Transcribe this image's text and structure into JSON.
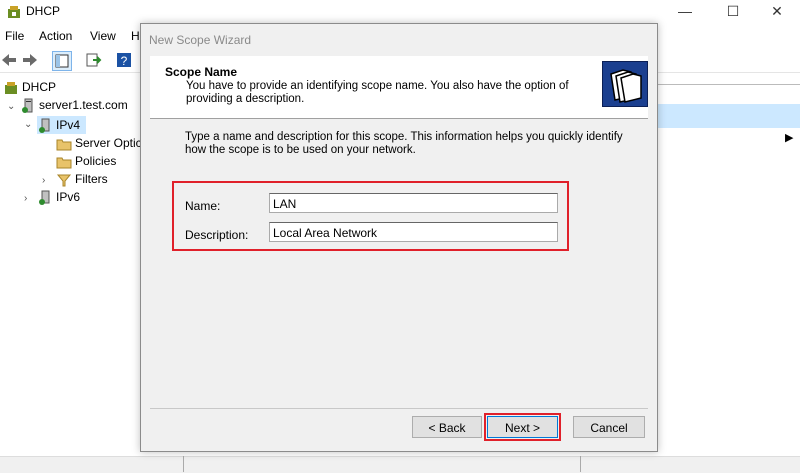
{
  "window": {
    "title": "DHCP",
    "controls": {
      "minimize": "—",
      "maximize": "☐",
      "close": "✕"
    }
  },
  "menubar": {
    "items": [
      "File",
      "Action",
      "View",
      "H"
    ]
  },
  "tree": {
    "root": "DHCP",
    "server": "server1.test.com",
    "ipv4": "IPv4",
    "server_options": "Server Optic",
    "policies": "Policies",
    "filters": "Filters",
    "ipv6": "IPv6"
  },
  "wizard": {
    "title": "New Scope Wizard",
    "header_title": "Scope Name",
    "header_desc": "You have to provide an identifying scope name. You also have the option of providing a description.",
    "body_text": "Type a name and description for this scope. This information helps you quickly identify how the scope is to be used on your network.",
    "name_label": "Name:",
    "name_value": "LAN",
    "description_label": "Description:",
    "description_value": "Local Area Network",
    "back_label": "< Back",
    "next_label": "Next >",
    "cancel_label": "Cancel"
  },
  "colors": {
    "highlight": "#e0202a",
    "selection": "#cce8ff",
    "dialog_bg": "#f0f0f0"
  }
}
